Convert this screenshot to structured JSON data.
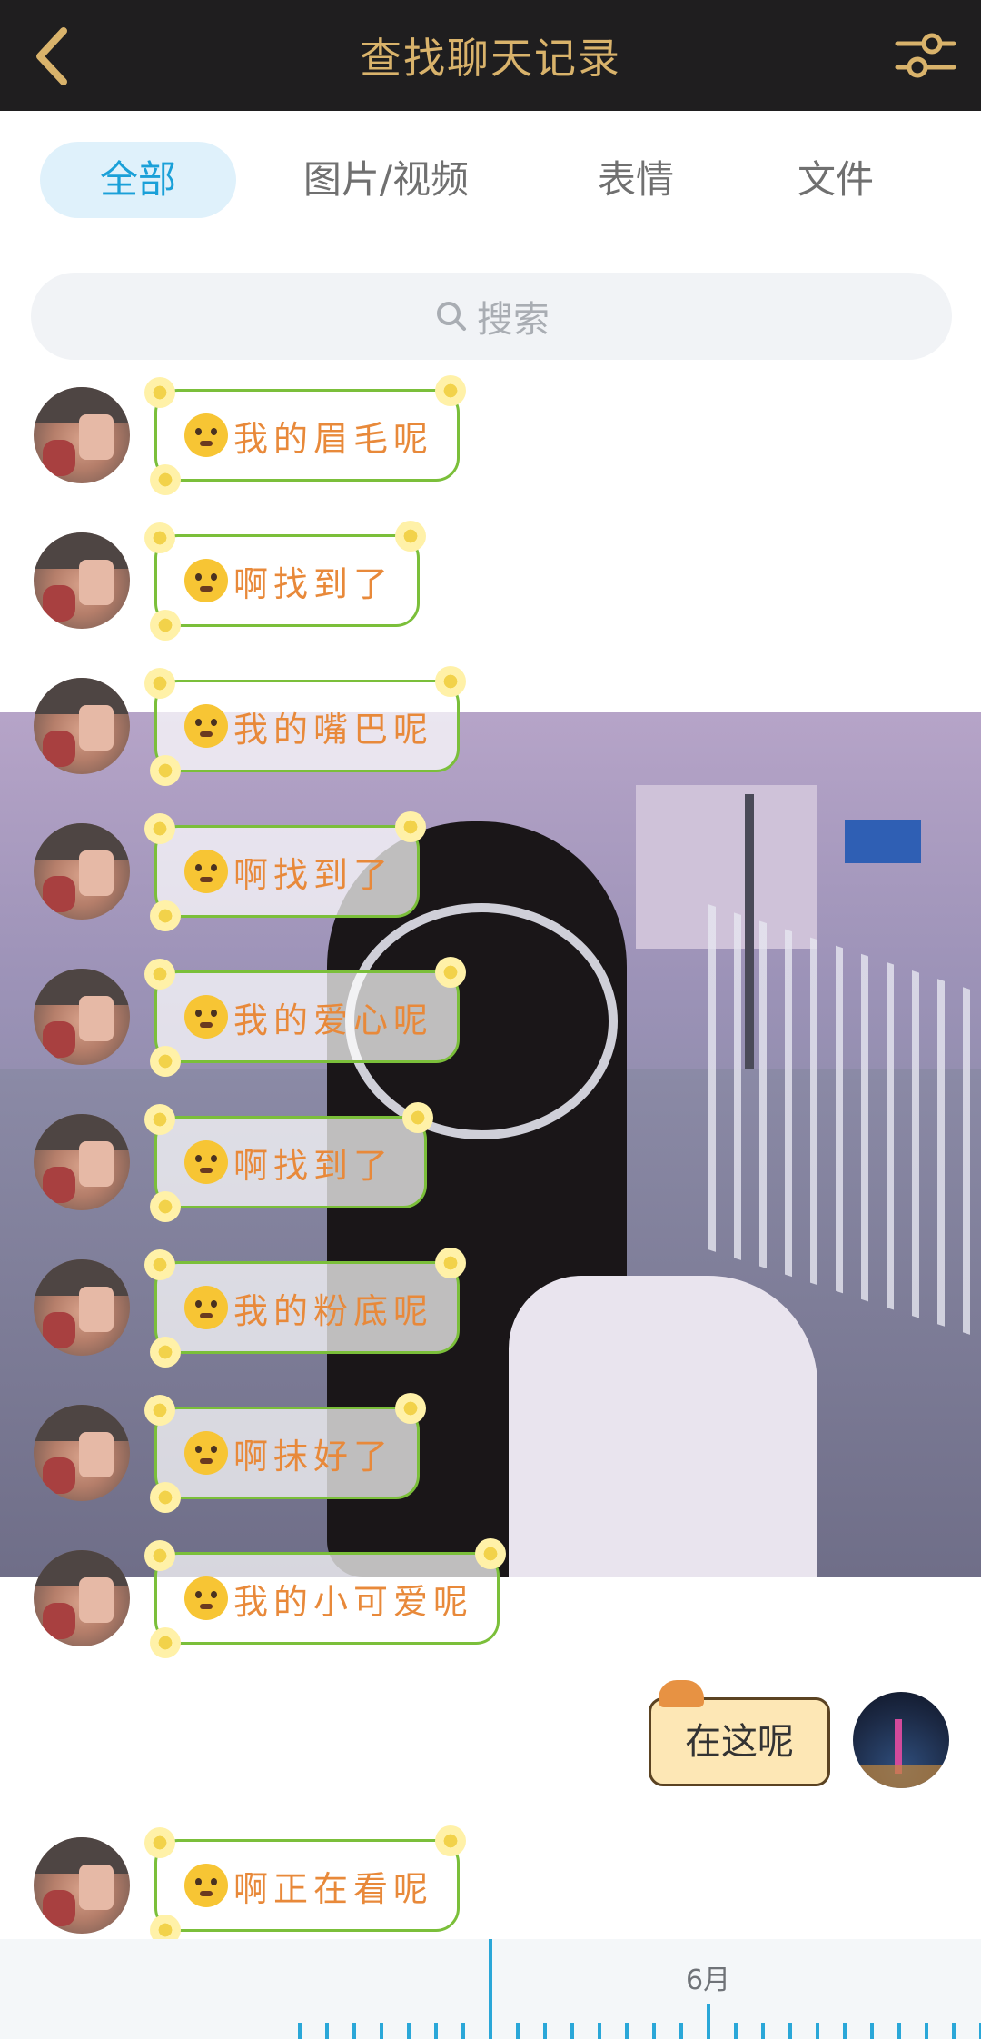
{
  "header": {
    "title": "查找聊天记录",
    "icons": {
      "back": "back-icon",
      "filter": "filter-icon"
    },
    "colors": {
      "background": "#1f1e1f",
      "accent": "#d9b36b"
    }
  },
  "tabs": [
    {
      "label": "全部",
      "active": true
    },
    {
      "label": "图片/视频",
      "active": false
    },
    {
      "label": "表情",
      "active": false
    },
    {
      "label": "文件",
      "active": false
    }
  ],
  "search": {
    "placeholder": "搜索",
    "icon": "search-icon"
  },
  "messages": [
    {
      "sender": "other",
      "emoji": "frowning-face",
      "text": "我的眉毛呢"
    },
    {
      "sender": "other",
      "emoji": "anguished-face",
      "text": "啊找到了"
    },
    {
      "sender": "other",
      "emoji": "face-without-mouth",
      "text": "我的嘴巴呢"
    },
    {
      "sender": "other",
      "emoji": "tongue-out-face",
      "text": "啊找到了"
    },
    {
      "sender": "other",
      "emoji": "kissing-face",
      "text": "我的爱心呢"
    },
    {
      "sender": "other",
      "emoji": "blowing-kiss-face",
      "text": "啊找到了"
    },
    {
      "sender": "other",
      "emoji": "new-moon-face",
      "text": "我的粉底呢"
    },
    {
      "sender": "other",
      "emoji": "full-moon-face",
      "text": "啊抹好了"
    },
    {
      "sender": "other",
      "emoji": "purple-heart",
      "text": "我的小可爱呢"
    },
    {
      "sender": "me",
      "text": "在这呢"
    },
    {
      "sender": "other",
      "emoji": "sparkling-heart",
      "text": "啊正在看呢"
    }
  ],
  "timeline": {
    "month_label": "6月",
    "accent": "#2aa7d8"
  }
}
